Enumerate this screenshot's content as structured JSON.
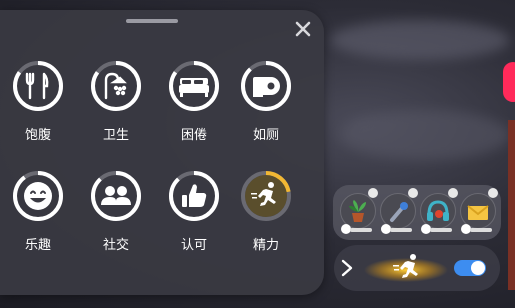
{
  "needs": [
    {
      "id": "hunger",
      "label": "饱腹",
      "icon": "fork-knife-icon",
      "fill": 0.85
    },
    {
      "id": "hygiene",
      "label": "卫生",
      "icon": "shower-icon",
      "fill": 0.85
    },
    {
      "id": "energy",
      "label": "困倦",
      "icon": "bed-icon",
      "fill": 0.85
    },
    {
      "id": "bladder",
      "label": "如厕",
      "icon": "toilet-paper-icon",
      "fill": 0.88
    },
    {
      "id": "fun",
      "label": "乐趣",
      "icon": "smile-icon",
      "fill": 0.9
    },
    {
      "id": "social",
      "label": "社交",
      "icon": "people-icon",
      "fill": 0.88
    },
    {
      "id": "esteem",
      "label": "认可",
      "icon": "thumbs-up-icon",
      "fill": 0.88
    },
    {
      "id": "stamina",
      "label": "精力",
      "icon": "runner-icon",
      "fill": 0.22
    }
  ],
  "colors": {
    "ring": "#ffffff",
    "ring_track": "#6a6a72",
    "ring_low": "#f2b833",
    "toggle": "#3d8df0"
  },
  "items": [
    {
      "icon": "potted-plant-icon"
    },
    {
      "icon": "wrench-icon"
    },
    {
      "icon": "headphones-icon"
    },
    {
      "icon": "envelope-icon"
    }
  ],
  "bottom_bar": {
    "icon": "runner-boost-icon",
    "toggle_on": true
  }
}
